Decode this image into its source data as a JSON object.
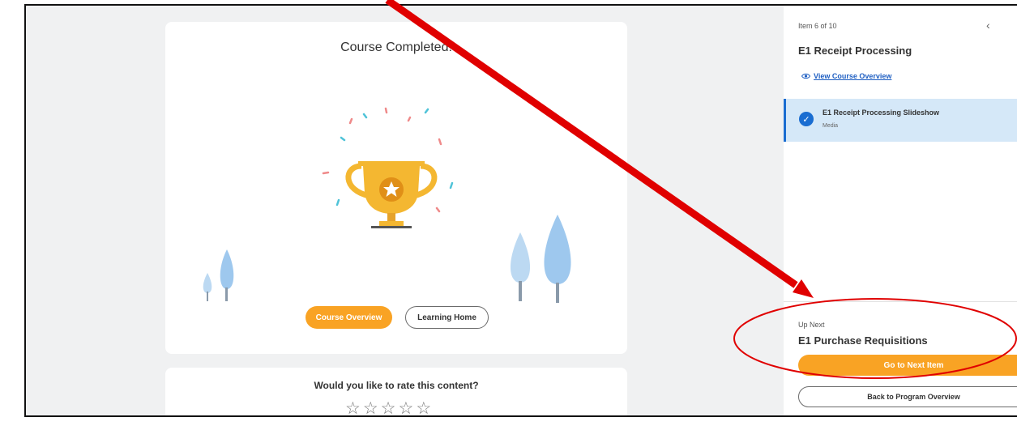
{
  "course": {
    "completed_title": "Course Completed!",
    "overview_button": "Course Overview",
    "learning_home_button": "Learning Home"
  },
  "rating": {
    "question": "Would you like to rate this content?",
    "stars": [
      "☆",
      "☆",
      "☆",
      "☆",
      "☆"
    ]
  },
  "sidebar": {
    "item_count": "Item 6 of 10",
    "title": "E1 Receipt Processing",
    "view_overview_link": "View Course Overview",
    "active_item": {
      "title": "E1 Receipt Processing Slideshow",
      "type": "Media"
    },
    "up_next": {
      "label": "Up Next",
      "title": "E1 Purchase Requisitions",
      "next_button": "Go to Next Item",
      "back_button": "Back to Program Overview"
    }
  },
  "colors": {
    "accent_orange": "#f9a324",
    "active_blue": "#1a6dd1",
    "annotation_red": "#e00000"
  }
}
